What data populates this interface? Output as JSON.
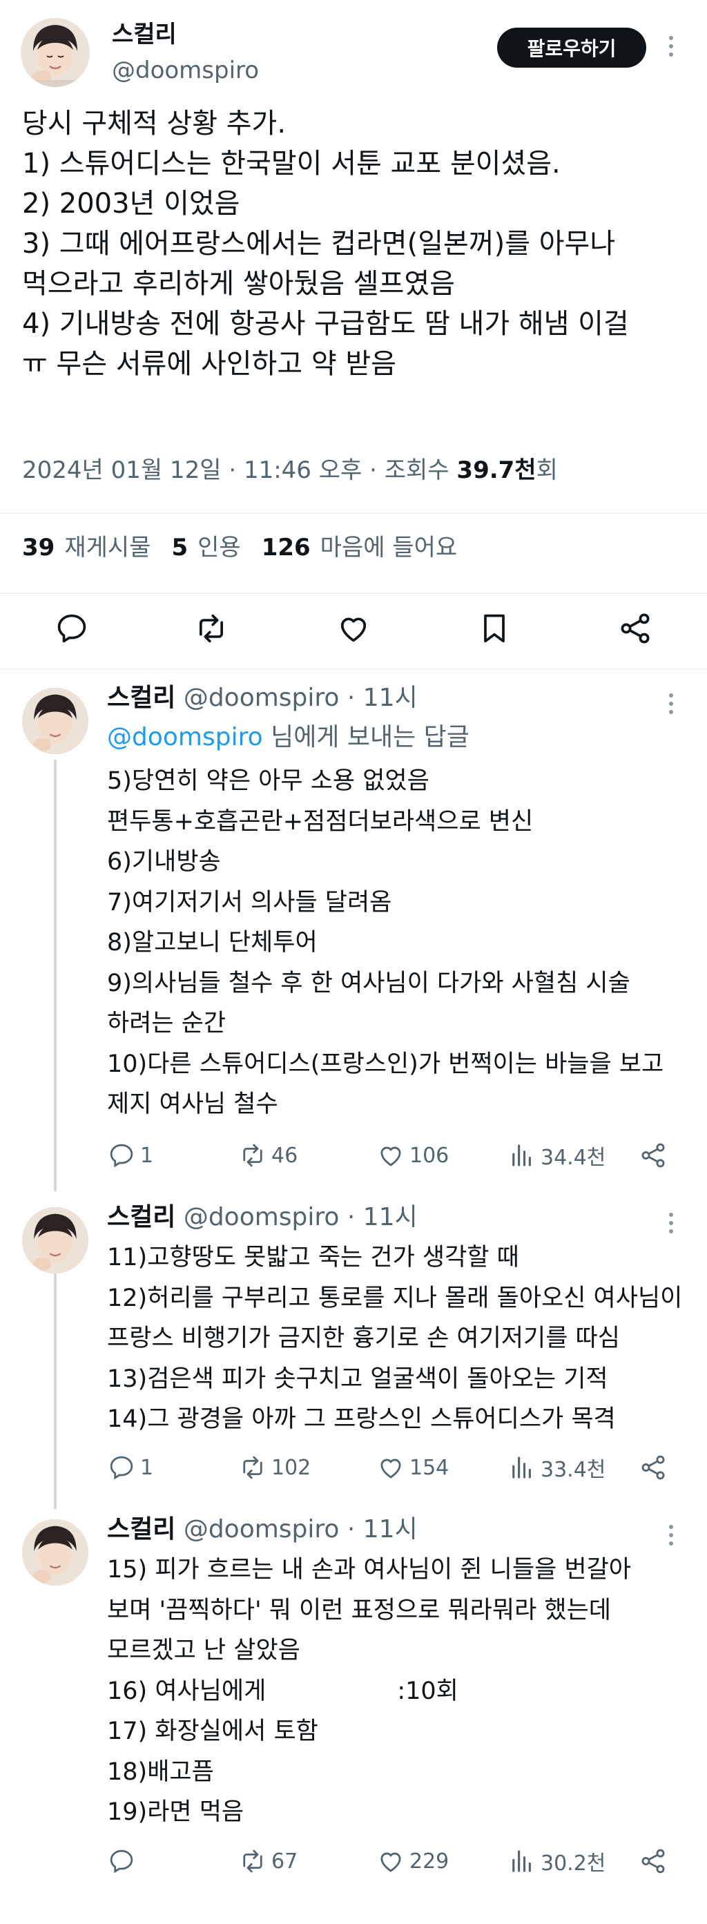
{
  "main_tweet": {
    "author": {
      "name": "스컬리",
      "handle": "@doomspiro"
    },
    "follow_label": "팔로우하기",
    "lines": [
      "당시 구체적 상황 추가.",
      "1) 스튜어디스는 한국말이 서툰 교포 분이셨음.",
      "2) 2003년 이었음",
      "3) 그때 에어프랑스에서는 컵라면(일본꺼)를 아무나",
      "먹으라고 후리하게 쌓아뒀음 셀프였음",
      "4) 기내방송 전에 항공사 구급함도 땀  내가 해냄 이걸",
      "ㅠ 무슨 서류에 사인하고 약 받음"
    ],
    "meta": {
      "date": "2024년 01월 12일",
      "sep1": " · ",
      "time": "11:46 오후",
      "sep2": " · ",
      "views_label": "조회수 ",
      "views_value": "39.7천",
      "views_suffix": "회"
    },
    "stats": {
      "reposts_count": "39",
      "reposts_label": "재게시물",
      "quotes_count": "5",
      "quotes_label": "인용",
      "likes_count": "126",
      "likes_label": "마음에 들어요"
    },
    "action_icons": [
      "reply-icon",
      "repost-icon",
      "like-icon",
      "bookmark-icon",
      "share-icon"
    ]
  },
  "replies": [
    {
      "name": "스컬리",
      "handle": "@doomspiro",
      "time": " · 11시",
      "reply_to_mention": "@doomspiro",
      "reply_to_suffix": " 님에게 보내는 답글",
      "lines": [
        "5)당연히 약은 아무 소용 없었음",
        "편두통+호흡곤란+점점더보라색으로 변신",
        "6)기내방송",
        "7)여기저기서 의사들 달려옴",
        "8)알고보니 단체투어",
        "9)의사님들 철수 후 한 여사님이 다가와 사혈침 시술",
        "하려는 순간",
        "10)다른 스튜어디스(프랑스인)가 번쩍이는 바늘을 보고",
        "제지 여사님 철수"
      ],
      "stats": {
        "replies": "1",
        "reposts": "46",
        "likes": "106",
        "views": "34.4천"
      }
    },
    {
      "name": "스컬리",
      "handle": "@doomspiro",
      "time": " · 11시",
      "lines": [
        "11)고향땅도 못밟고 죽는 건가 생각할 때",
        "12)허리를 구부리고 통로를 지나 몰래 돌아오신 여사님이",
        "프랑스 비행기가 금지한 흉기로 손 여기저기를 따심",
        "13)검은색 피가 솟구치고 얼굴색이 돌아오는 기적",
        "14)그 광경을 아까 그 프랑스인 스튜어디스가 목격"
      ],
      "stats": {
        "replies": "1",
        "reposts": "102",
        "likes": "154",
        "views": "33.4천"
      }
    },
    {
      "name": "스컬리",
      "handle": "@doomspiro",
      "time": " · 11시",
      "lines": [
        "15) 피가 흐르는 내 손과 여사님이 쥔 니들을 번갈아",
        "보며 '끔찍하다' 뭐 이런 표정으로 뭐라뭐라 했는데",
        "모르겠고 난 살았음",
        "16) 여사님에게",
        "17) 화장실에서 토함",
        "18)배고픔",
        "19)라면 먹음"
      ],
      "line16_suffix": ":10회",
      "stats": {
        "replies": "",
        "reposts": "67",
        "likes": "229",
        "views": "30.2천"
      }
    }
  ],
  "colors": {
    "text": "#0f1419",
    "secondary": "#536471",
    "link": "#1d9bf0",
    "divider": "#eff3f4",
    "thread": "#cfd9de",
    "button": "#0f1419"
  }
}
